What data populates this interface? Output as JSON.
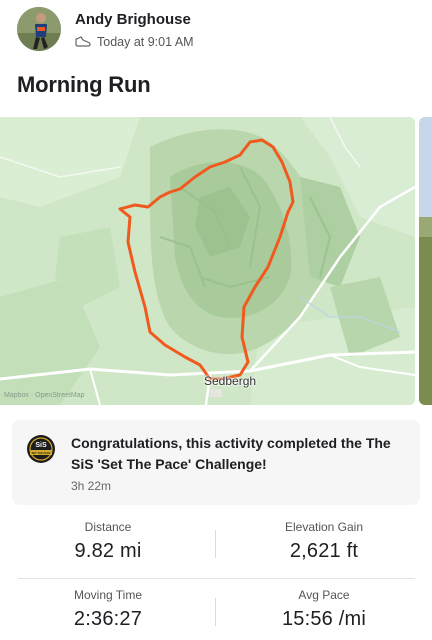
{
  "owner": {
    "name": "Andy Brighouse",
    "timestamp": "Today at 9:01 AM",
    "avatar_icon": "runner-avatar",
    "activity_type_icon": "shoe-icon"
  },
  "activity": {
    "title": "Morning Run"
  },
  "map": {
    "place_label": "Sedbergh",
    "attribution": "Mapbox · OpenStreetMap",
    "route_color": "#f05a1e"
  },
  "challenge": {
    "badge_icon": "sis-set-the-pace-badge",
    "badge_text": "SiS",
    "badge_subtext": "SET THE PACE",
    "text": "Congratulations, this activity completed the The SiS 'Set The Pace' Challenge!",
    "duration": "3h 22m"
  },
  "stats": [
    {
      "label": "Distance",
      "value": "9.82 mi"
    },
    {
      "label": "Elevation Gain",
      "value": "2,621 ft"
    },
    {
      "label": "Moving Time",
      "value": "2:36:27"
    },
    {
      "label": "Avg Pace",
      "value": "15:56 /mi"
    }
  ]
}
